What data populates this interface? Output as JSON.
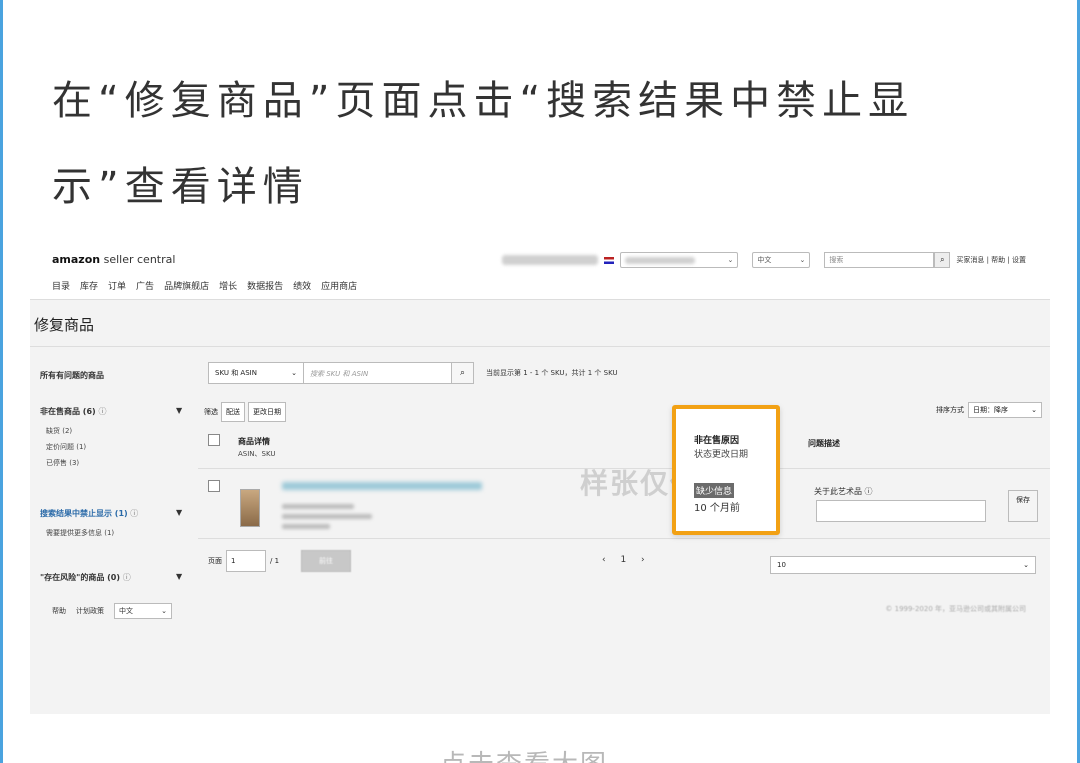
{
  "headline": {
    "line1": "在“修复商品”页面点击“搜索结果中禁止显",
    "line2": "示”查看详情"
  },
  "screenshot": {
    "logo": {
      "brand": "amazon",
      "product": " seller central"
    },
    "nav": [
      "目录",
      "库存",
      "订单",
      "广告",
      "品牌旗舰店",
      "增长",
      "数据报告",
      "绩效",
      "应用商店"
    ],
    "topbar": {
      "language": "中文",
      "search_placeholder": "搜索",
      "links": "买家消息 | 帮助 | 设置"
    },
    "page_title": "修复商品",
    "sidebar": {
      "all_issues": "所有有问题的商品",
      "inactive": {
        "label": "非在售商品 (6)",
        "items": [
          "缺货 (2)",
          "定价问题 (1)",
          "已停售 (3)"
        ]
      },
      "suppressed": {
        "label": "搜索结果中禁止显示 (1)",
        "items": [
          "需要提供更多信息 (1)"
        ]
      },
      "at_risk": {
        "label": "\"存在风险\"的商品 (0)"
      },
      "info_icon": "ⓘ",
      "caret": "▼"
    },
    "search": {
      "select_value": "SKU 和 ASIN",
      "placeholder": "搜索 SKU 和 ASIN",
      "result_text": "当前显示第 1 - 1 个 SKU，共计 1 个 SKU"
    },
    "filter": {
      "label": "筛选",
      "chips": [
        "配送",
        "更改日期"
      ]
    },
    "sort": {
      "label": "排序方式",
      "value": "日期：降序"
    },
    "table": {
      "col_product": "商品详情",
      "col_product_sub": "ASIN、SKU",
      "col_issue": "问题描述",
      "about_label": "关于此艺术品 ⓘ",
      "save_label": "保存"
    },
    "watermark": "样张仅供参考",
    "callout": {
      "title": "非在售原因",
      "subtitle": "状态更改日期",
      "reason": "缺少信息",
      "time": "10 个月前"
    },
    "pagination": {
      "label": "页面",
      "page_value": "1",
      "total": "/ 1",
      "go_label": "前往",
      "pager": "‹ 1 ›",
      "per_page": "10"
    },
    "footer": {
      "help": "帮助",
      "policy": "计划政策",
      "language": "中文",
      "copyright": "© 1999-2020 年，亚马逊公司或其附属公司"
    }
  },
  "caption": "点击查看大图"
}
